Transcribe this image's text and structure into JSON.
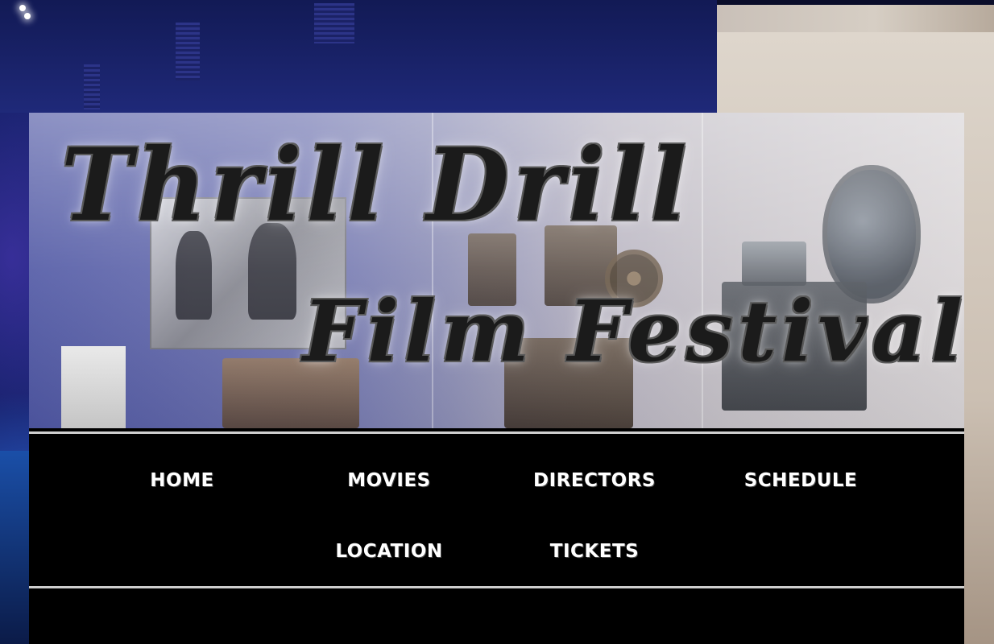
{
  "site": {
    "title_line_1": "Thrill Drill",
    "title_line_2": "Film Festival"
  },
  "nav": {
    "items": [
      {
        "label": "Home"
      },
      {
        "label": "Movies"
      },
      {
        "label": "Directors"
      },
      {
        "label": "Schedule"
      },
      {
        "label": "Location"
      },
      {
        "label": "Tickets"
      }
    ]
  },
  "colors": {
    "nav_background": "#000000",
    "nav_text": "#ffffff",
    "title_text": "#1b1b1b",
    "page_background": "#232a7e"
  },
  "icons": []
}
